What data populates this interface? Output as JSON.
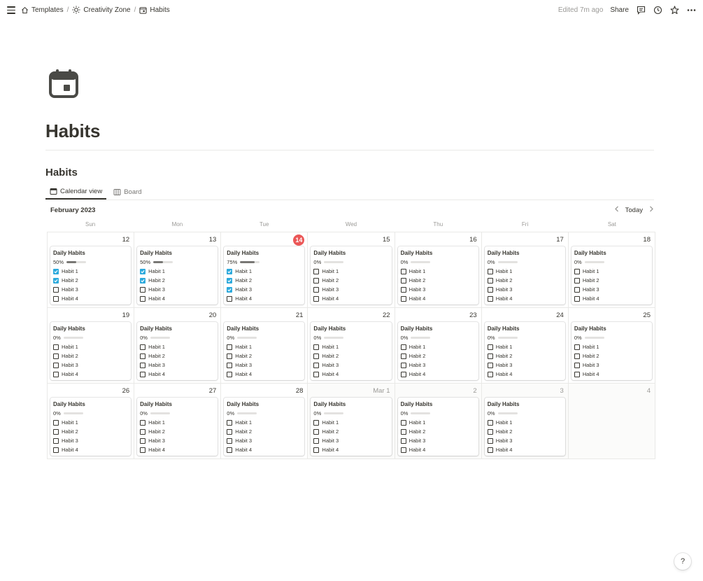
{
  "breadcrumb": [
    {
      "label": "Templates",
      "icon": "home-icon"
    },
    {
      "label": "Creativity Zone",
      "icon": "sun-icon"
    },
    {
      "label": "Habits",
      "icon": "calendar-icon"
    }
  ],
  "breadcrumb_separator": "/",
  "topbar": {
    "edited": "Edited 7m ago",
    "share": "Share"
  },
  "page": {
    "title": "Habits",
    "database_title": "Habits"
  },
  "tabs": [
    {
      "label": "Calendar view",
      "active": true,
      "icon": "calendar-view-icon"
    },
    {
      "label": "Board",
      "active": false,
      "icon": "board-icon"
    }
  ],
  "calendar": {
    "month_label": "February 2023",
    "today_label": "Today",
    "weekdays": [
      "Sun",
      "Mon",
      "Tue",
      "Wed",
      "Thu",
      "Fri",
      "Sat"
    ],
    "card_title": "Daily Habits",
    "habit_labels": [
      "Habit 1",
      "Habit 2",
      "Habit 3",
      "Habit 4"
    ],
    "days": [
      {
        "label": "12",
        "today": false,
        "outside": false,
        "has_card": true,
        "progress_label": "50%",
        "progress": 0.5,
        "checks": [
          true,
          true,
          false,
          false
        ]
      },
      {
        "label": "13",
        "today": false,
        "outside": false,
        "has_card": true,
        "progress_label": "50%",
        "progress": 0.5,
        "checks": [
          true,
          true,
          false,
          false
        ]
      },
      {
        "label": "14",
        "today": true,
        "outside": false,
        "has_card": true,
        "progress_label": "75%",
        "progress": 0.75,
        "checks": [
          true,
          true,
          true,
          false
        ]
      },
      {
        "label": "15",
        "today": false,
        "outside": false,
        "has_card": true,
        "progress_label": "0%",
        "progress": 0,
        "checks": [
          false,
          false,
          false,
          false
        ]
      },
      {
        "label": "16",
        "today": false,
        "outside": false,
        "has_card": true,
        "progress_label": "0%",
        "progress": 0,
        "checks": [
          false,
          false,
          false,
          false
        ]
      },
      {
        "label": "17",
        "today": false,
        "outside": false,
        "has_card": true,
        "progress_label": "0%",
        "progress": 0,
        "checks": [
          false,
          false,
          false,
          false
        ]
      },
      {
        "label": "18",
        "today": false,
        "outside": false,
        "has_card": true,
        "progress_label": "0%",
        "progress": 0,
        "checks": [
          false,
          false,
          false,
          false
        ]
      },
      {
        "label": "19",
        "today": false,
        "outside": false,
        "has_card": true,
        "progress_label": "0%",
        "progress": 0,
        "checks": [
          false,
          false,
          false,
          false
        ]
      },
      {
        "label": "20",
        "today": false,
        "outside": false,
        "has_card": true,
        "progress_label": "0%",
        "progress": 0,
        "checks": [
          false,
          false,
          false,
          false
        ]
      },
      {
        "label": "21",
        "today": false,
        "outside": false,
        "has_card": true,
        "progress_label": "0%",
        "progress": 0,
        "checks": [
          false,
          false,
          false,
          false
        ]
      },
      {
        "label": "22",
        "today": false,
        "outside": false,
        "has_card": true,
        "progress_label": "0%",
        "progress": 0,
        "checks": [
          false,
          false,
          false,
          false
        ]
      },
      {
        "label": "23",
        "today": false,
        "outside": false,
        "has_card": true,
        "progress_label": "0%",
        "progress": 0,
        "checks": [
          false,
          false,
          false,
          false
        ]
      },
      {
        "label": "24",
        "today": false,
        "outside": false,
        "has_card": true,
        "progress_label": "0%",
        "progress": 0,
        "checks": [
          false,
          false,
          false,
          false
        ]
      },
      {
        "label": "25",
        "today": false,
        "outside": false,
        "has_card": true,
        "progress_label": "0%",
        "progress": 0,
        "checks": [
          false,
          false,
          false,
          false
        ]
      },
      {
        "label": "26",
        "today": false,
        "outside": false,
        "has_card": true,
        "progress_label": "0%",
        "progress": 0,
        "checks": [
          false,
          false,
          false,
          false
        ]
      },
      {
        "label": "27",
        "today": false,
        "outside": false,
        "has_card": true,
        "progress_label": "0%",
        "progress": 0,
        "checks": [
          false,
          false,
          false,
          false
        ]
      },
      {
        "label": "28",
        "today": false,
        "outside": false,
        "has_card": true,
        "progress_label": "0%",
        "progress": 0,
        "checks": [
          false,
          false,
          false,
          false
        ]
      },
      {
        "label": "Mar 1",
        "today": false,
        "outside": true,
        "has_card": true,
        "progress_label": "0%",
        "progress": 0,
        "checks": [
          false,
          false,
          false,
          false
        ]
      },
      {
        "label": "2",
        "today": false,
        "outside": true,
        "has_card": true,
        "progress_label": "0%",
        "progress": 0,
        "checks": [
          false,
          false,
          false,
          false
        ]
      },
      {
        "label": "3",
        "today": false,
        "outside": true,
        "has_card": true,
        "progress_label": "0%",
        "progress": 0,
        "checks": [
          false,
          false,
          false,
          false
        ]
      },
      {
        "label": "4",
        "today": false,
        "outside": true,
        "has_card": false
      }
    ]
  },
  "help": "?",
  "colors": {
    "text": "#37352f",
    "muted": "#9b9a97",
    "today_badge": "#eb5757",
    "checkbox_checked": "#2eaadc",
    "progress_fill": "#787774"
  }
}
